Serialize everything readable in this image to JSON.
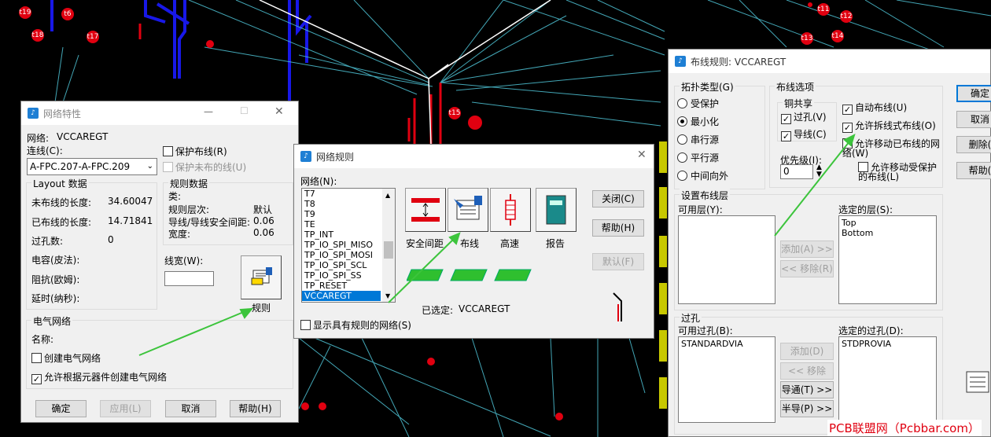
{
  "background": {
    "markers": [
      "t19",
      "t6",
      "t18",
      "t17",
      "t15",
      "t11",
      "t12",
      "t13",
      "t14"
    ]
  },
  "watermark": "PCB联盟网（Pcbbar.com）",
  "net_props": {
    "title": "网络特性",
    "net_label": "网络:",
    "net_value": "VCCAREGT",
    "connect_label": "连线(C):",
    "connect_value": "A-FPC.207-A-FPC.209",
    "protect_route": "保护布线(R)",
    "protect_unrouted": "保护未布的线(U)",
    "layout_group": "Layout 数据",
    "unrouted_len_label": "未布线的长度:",
    "unrouted_len": "34.60047",
    "routed_len_label": "已布线的长度:",
    "routed_len": "14.71841",
    "via_count_label": "过孔数:",
    "via_count": "0",
    "cap_label": "电容(皮法):",
    "res_label": "阻抗(欧姆):",
    "delay_label": "延时(纳秒):",
    "rules_group": "规则数据",
    "class_label": "类:",
    "rule_level_label": "规则层次:",
    "rule_level_value": "默认",
    "clearance_label": "导线/导线安全间距:",
    "clearance_value": "0.06",
    "width_label": "宽度:",
    "width_value": "0.06",
    "line_width_label": "线宽(W):",
    "rules_button": "规则",
    "elec_group": "电气网络",
    "name_label": "名称:",
    "create_elec": "创建电气网络",
    "allow_create_elec": "允许根据元器件创建电气网络",
    "ok": "确定",
    "apply": "应用(L)",
    "cancel": "取消",
    "help": "帮助(H)"
  },
  "net_rules": {
    "title": "网络规则",
    "net_label": "网络(N):",
    "nets": [
      "T7",
      "T8",
      "T9",
      "TE",
      "TP_INT",
      "TP_IO_SPI_MISO",
      "TP_IO_SPI_MOSI",
      "TP_IO_SPI_SCL",
      "TP_IO_SPI_SS",
      "TP_RESET",
      "VCCAREGT"
    ],
    "selected_net": "VCCAREGT",
    "clearance": "安全间距",
    "routing": "布线",
    "highspeed": "高速",
    "report": "报告",
    "close": "关闭(C)",
    "help": "帮助(H)",
    "default": "默认(F)",
    "selected_label": "已选定:",
    "selected_value": "VCCAREGT",
    "show_with_rules": "显示具有规则的网络(S)"
  },
  "routing_rules": {
    "title": "布线规则: VCCAREGT",
    "topology_group": "拓扑类型(G)",
    "topology": [
      "受保护",
      "最小化",
      "串行源",
      "平行源",
      "中间向外"
    ],
    "topology_selected": "最小化",
    "route_opts_group": "布线选项",
    "copper_share": "铜共享",
    "via_opt": "过孔(V)",
    "trace_opt": "导线(C)",
    "auto_route": "自动布线(U)",
    "allow_rip": "允许拆线式布线(O)",
    "allow_move_routed": "允许移动已布线的网络(W)",
    "allow_move_protected": "允许移动受保护的布线(L)",
    "priority_label": "优先级(I):",
    "priority_value": "0",
    "layers_group": "设置布线层",
    "avail_layers": "可用层(Y):",
    "sel_layers": "选定的层(S):",
    "layers": [
      "Top",
      "Bottom"
    ],
    "add_layer": "添加(A) >>",
    "remove_layer": "<< 移除(R)",
    "vias_group": "过孔",
    "avail_vias": "可用过孔(B):",
    "avail_via_list": [
      "STANDARDVIA"
    ],
    "sel_vias": "选定的过孔(D):",
    "sel_via_list": [
      "STDPROVIA"
    ],
    "add_via": "添加(D) >>",
    "remove_via": "<< 移除(M)",
    "lead_via": "导通(T) >>",
    "half_via": "半导(P) >>",
    "ok": "确定",
    "cancel": "取消",
    "delete": "删除(",
    "help": "帮助("
  }
}
